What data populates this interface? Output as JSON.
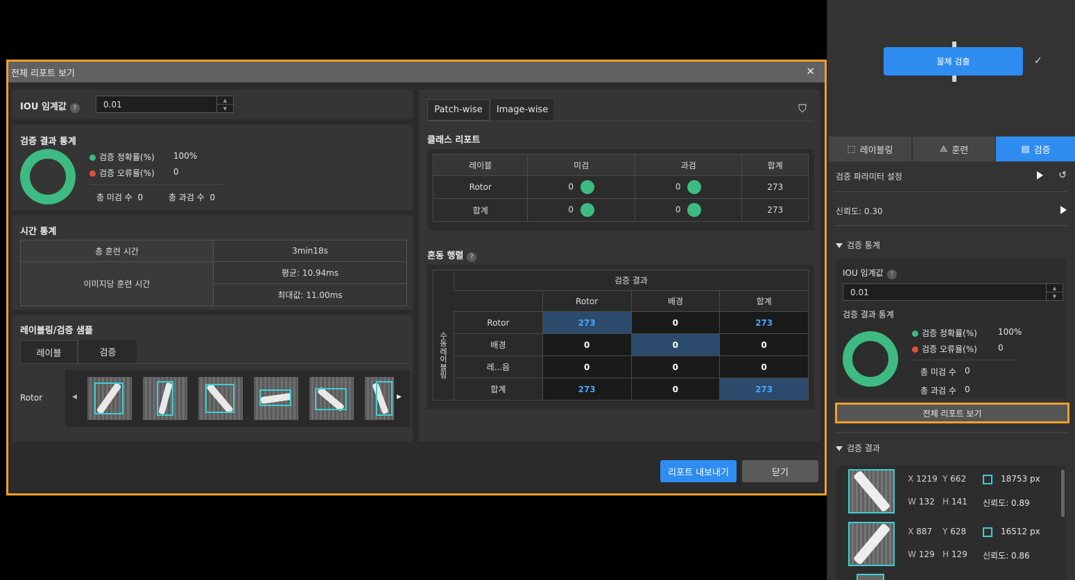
{
  "right_panel": {
    "node_button": "물체 검출",
    "tabs": [
      {
        "label": "레이블링",
        "icon": "labeling-icon"
      },
      {
        "label": "훈련",
        "icon": "training-icon"
      },
      {
        "label": "검증",
        "icon": "validation-icon"
      }
    ],
    "active_tab": "검증",
    "param_settings_label": "검증 파라미터 설정",
    "confidence_label": "신뢰도: 0.30",
    "stats_section_label": "검증 통계",
    "iou_label": "IOU 임계값",
    "iou_value": "0.01",
    "result_stats_label": "검증 결과 통계",
    "accuracy_label": "검증 정확률(%)",
    "accuracy_value": "100%",
    "error_label": "검증 오류율(%)",
    "error_value": "0",
    "miss_label": "총 미검 수",
    "miss_value": "0",
    "over_label": "총 과검 수",
    "over_value": "0",
    "full_report_button": "전체 리포트 보기",
    "results_section_label": "검증 결과",
    "results": [
      {
        "x_label": "X",
        "x": "1219",
        "y_label": "Y",
        "y": "662",
        "area": "18753 px",
        "w_label": "W",
        "w": "132",
        "h_label": "H",
        "h": "141",
        "conf": "신뢰도: 0.89"
      },
      {
        "x_label": "X",
        "x": "887",
        "y_label": "Y",
        "y": "628",
        "area": "16512 px",
        "w_label": "W",
        "w": "129",
        "h_label": "H",
        "h": "129",
        "conf": "신뢰도: 0.86"
      }
    ]
  },
  "dialog": {
    "title": "전체 리포트 보기",
    "iou_label": "IOU 임계값",
    "iou_value": "0.01",
    "result_stats_title": "검증 결과 통계",
    "accuracy_label": "검증 정확률(%)",
    "accuracy_value": "100%",
    "error_label": "검증 오류율(%)",
    "error_value": "0",
    "miss_label": "총 미검 수",
    "miss_value": "0",
    "over_label": "총 과검 수",
    "over_value": "0",
    "time_title": "시간 통계",
    "total_train_time_label": "총 훈련 시간",
    "total_train_time_value": "3min18s",
    "per_image_label": "이미지당 훈련 시간",
    "avg_value": "평균: 10.94ms",
    "max_value": "최대값: 11.00ms",
    "samples_title": "레이블링/검증 샘플",
    "sample_tabs": [
      "레이블",
      "검증"
    ],
    "sample_class": "Rotor",
    "view_tabs": [
      "Patch-wise",
      "Image-wise"
    ],
    "class_report_title": "클래스 리포트",
    "class_headers": [
      "레이블",
      "미검",
      "과검",
      "합계"
    ],
    "class_rows": [
      {
        "label": "Rotor",
        "miss": "0",
        "over": "0",
        "total": "273"
      },
      {
        "label": "합계",
        "miss": "0",
        "over": "0",
        "total": "273"
      }
    ],
    "confusion_title": "혼동 행렬",
    "cm_top_header": "검증 결과",
    "cm_side_header": "수동 레이블링",
    "cm_col_headers": [
      "Rotor",
      "배경",
      "합계"
    ],
    "cm_rows": [
      {
        "label": "Rotor",
        "values": [
          "273",
          "0",
          "273"
        ]
      },
      {
        "label": "배경",
        "values": [
          "0",
          "0",
          "0"
        ]
      },
      {
        "label": "레...음",
        "values": [
          "0",
          "0",
          "0"
        ]
      },
      {
        "label": "합계",
        "values": [
          "273",
          "0",
          "273"
        ]
      }
    ],
    "export_button": "리포트 내보내기",
    "close_button": "닫기"
  },
  "colors": {
    "accent": "#2f8cf0",
    "highlight_border": "#f5a02a",
    "success": "#3dbb83",
    "error": "#e0503c",
    "bbox": "#3ad0d6"
  }
}
